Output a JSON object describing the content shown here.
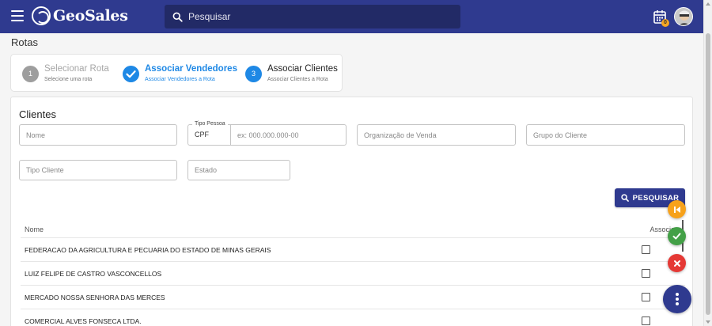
{
  "header": {
    "brand": "GeoSales",
    "search": {
      "placeholder": "Pesquisar",
      "value": ""
    },
    "notification_count": "0",
    "accent_color": "#2f3a8f"
  },
  "page": {
    "title": "Rotas"
  },
  "stepper": {
    "steps": [
      {
        "number": "1",
        "title": "Selecionar Rota",
        "subtitle": "Selecione uma rota",
        "state": "inactive"
      },
      {
        "number": "",
        "title": "Associar Vendedores",
        "subtitle": "Associar Vendedores a Rota",
        "state": "completed"
      },
      {
        "number": "3",
        "title": "Associar Clientes",
        "subtitle": "Associar Clientes a Rota",
        "state": "active"
      }
    ]
  },
  "clientes": {
    "title": "Clientes",
    "fields": {
      "nome": {
        "placeholder": "Nome",
        "value": ""
      },
      "tipo_pessoa": {
        "legend": "Tipo Pessoa",
        "selected": "CPF",
        "placeholder": "ex: 000.000.000-00",
        "value": ""
      },
      "organizacao": {
        "placeholder": "Organização de Venda",
        "value": ""
      },
      "grupo": {
        "placeholder": "Grupo do Cliente",
        "value": ""
      },
      "tipo_cliente": {
        "placeholder": "Tipo Cliente",
        "value": ""
      },
      "estado": {
        "placeholder": "Estado",
        "value": ""
      }
    },
    "search_button": "PESQUISAR",
    "table": {
      "columns": [
        "Nome",
        "Associar"
      ],
      "rows": [
        {
          "nome": "FEDERACAO DA AGRICULTURA E PECUARIA DO ESTADO DE MINAS GERAIS",
          "associar": false
        },
        {
          "nome": "LUIZ FELIPE DE CASTRO VASCONCELLOS",
          "associar": false
        },
        {
          "nome": "MERCADO NOSSA SENHORA DAS MERCES",
          "associar": false
        },
        {
          "nome": "COMERCIAL ALVES FONSECA LTDA.",
          "associar": false
        }
      ]
    }
  },
  "actions": {
    "back_color": "#f7a21b",
    "confirm_color": "#43a047",
    "cancel_color": "#e53935",
    "more_color": "#2f3a8f"
  }
}
